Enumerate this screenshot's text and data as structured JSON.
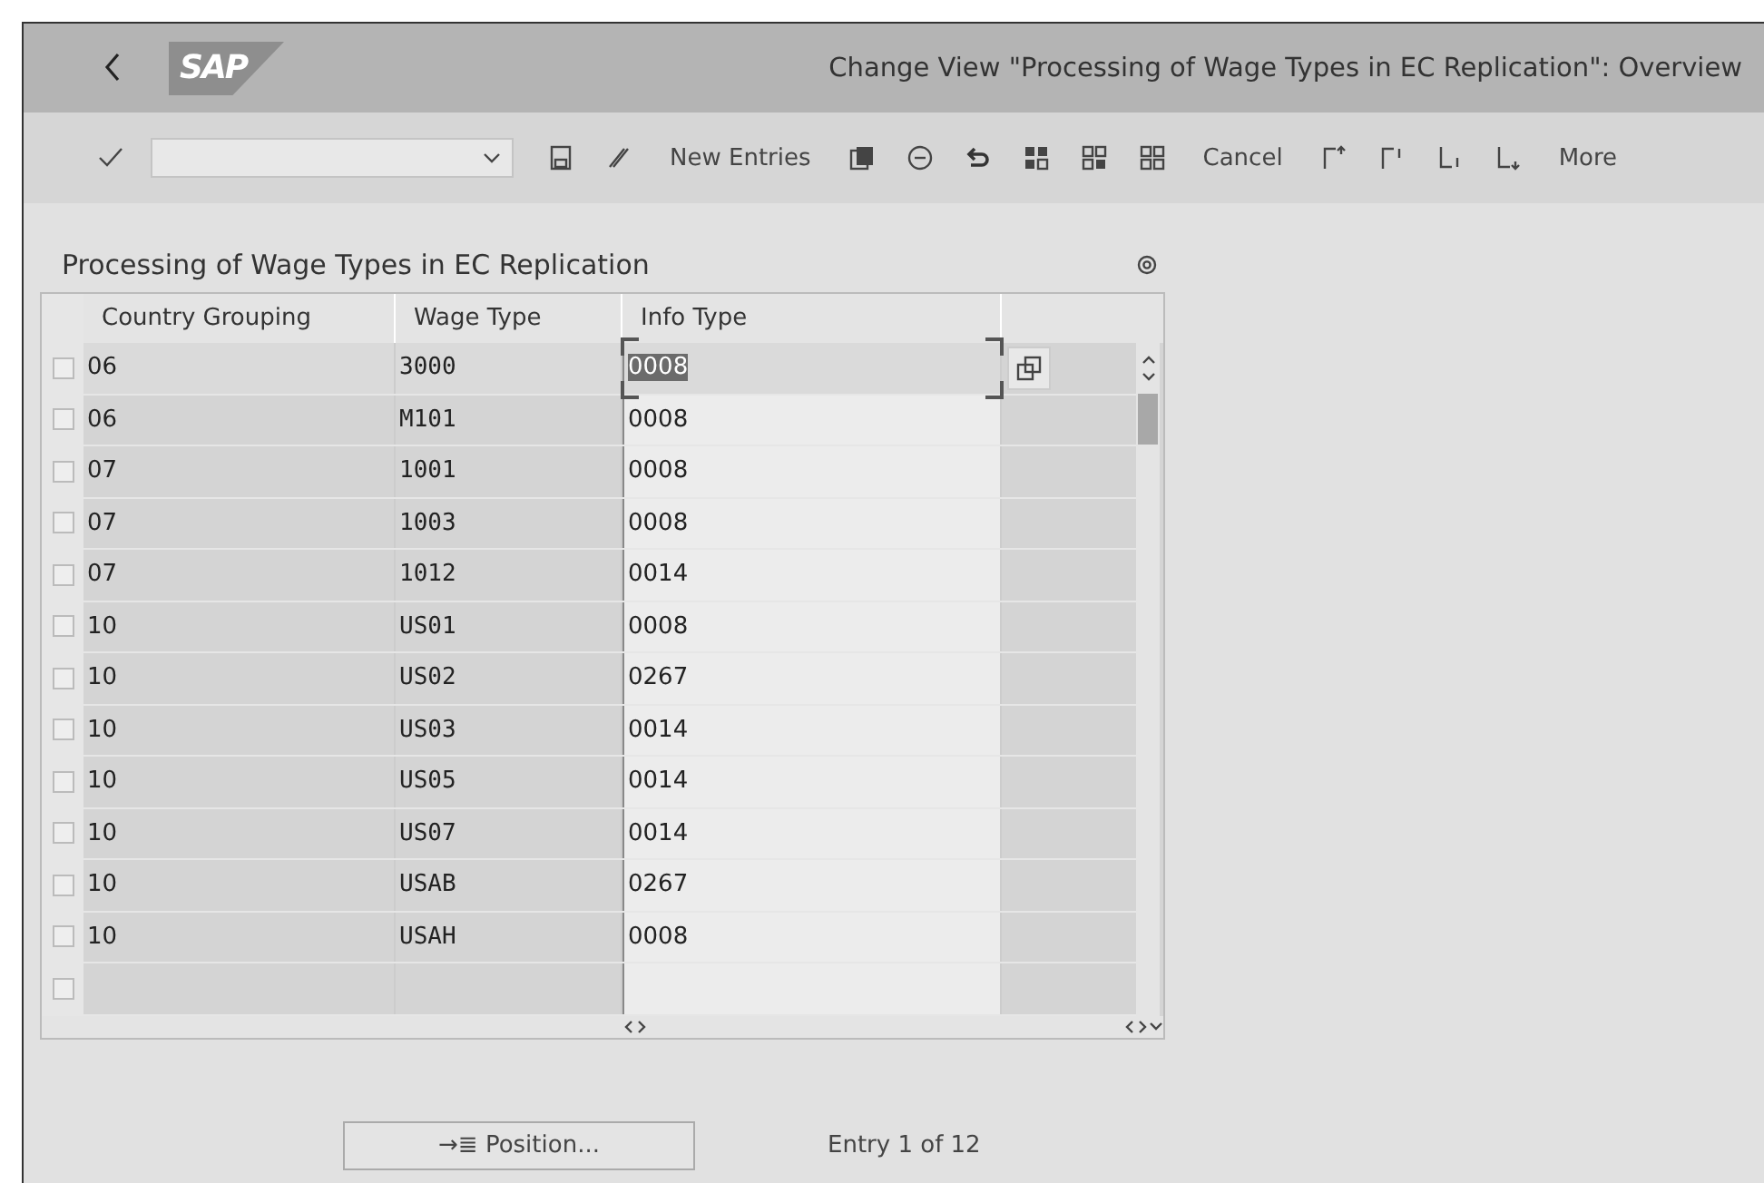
{
  "header": {
    "logo": "SAP",
    "title": "Change View \"Processing of Wage Types in EC Replication\": Overview"
  },
  "toolbar": {
    "new_entries": "New Entries",
    "cancel": "Cancel",
    "more": "More"
  },
  "table": {
    "title": "Processing of Wage Types in EC Replication",
    "columns": [
      "Country Grouping",
      "Wage Type",
      "Info Type"
    ],
    "rows": [
      {
        "country_grouping": "06",
        "wage_type": "3000",
        "info_type": "0008",
        "selected": false,
        "focused": true
      },
      {
        "country_grouping": "06",
        "wage_type": "M101",
        "info_type": "0008",
        "selected": false,
        "focused": false
      },
      {
        "country_grouping": "07",
        "wage_type": "1001",
        "info_type": "0008",
        "selected": false,
        "focused": false
      },
      {
        "country_grouping": "07",
        "wage_type": "1003",
        "info_type": "0008",
        "selected": false,
        "focused": false
      },
      {
        "country_grouping": "07",
        "wage_type": "1012",
        "info_type": "0014",
        "selected": false,
        "focused": false
      },
      {
        "country_grouping": "10",
        "wage_type": "US01",
        "info_type": "0008",
        "selected": false,
        "focused": false
      },
      {
        "country_grouping": "10",
        "wage_type": "US02",
        "info_type": "0267",
        "selected": false,
        "focused": false
      },
      {
        "country_grouping": "10",
        "wage_type": "US03",
        "info_type": "0014",
        "selected": false,
        "focused": false
      },
      {
        "country_grouping": "10",
        "wage_type": "US05",
        "info_type": "0014",
        "selected": false,
        "focused": false
      },
      {
        "country_grouping": "10",
        "wage_type": "US07",
        "info_type": "0014",
        "selected": false,
        "focused": false
      },
      {
        "country_grouping": "10",
        "wage_type": "USAB",
        "info_type": "0267",
        "selected": false,
        "focused": false
      },
      {
        "country_grouping": "10",
        "wage_type": "USAH",
        "info_type": "0008",
        "selected": false,
        "focused": false
      }
    ],
    "blank_row": {
      "selected": false
    }
  },
  "footer": {
    "position_button": "Position...",
    "position_icon": "→≣",
    "entry_count": "Entry 1 of 12"
  }
}
